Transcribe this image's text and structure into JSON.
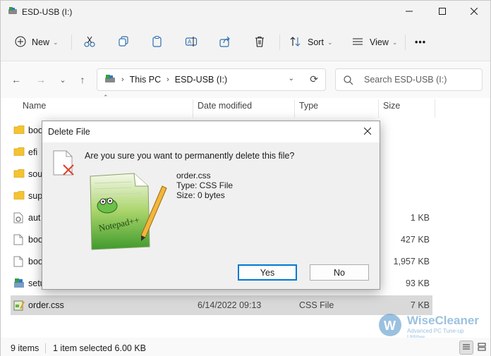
{
  "window": {
    "title": "ESD-USB (I:)"
  },
  "commandbar": {
    "new_label": "New",
    "sort_label": "Sort",
    "view_label": "View",
    "more_label": "•••"
  },
  "address": {
    "segments": [
      "This PC",
      "ESD-USB (I:)"
    ]
  },
  "search": {
    "placeholder": "Search ESD-USB (I:)"
  },
  "columns": {
    "name": "Name",
    "date": "Date modified",
    "type": "Type",
    "size": "Size"
  },
  "files": [
    {
      "name": "boo",
      "date": "",
      "type": "",
      "size": "",
      "icon": "folder-icon"
    },
    {
      "name": "efi",
      "date": "",
      "type": "",
      "size": "",
      "icon": "folder-icon"
    },
    {
      "name": "sou",
      "date": "",
      "type": "",
      "size": "",
      "icon": "folder-icon"
    },
    {
      "name": "sup",
      "date": "",
      "type": "",
      "size": "",
      "icon": "folder-icon"
    },
    {
      "name": "aut",
      "date": "",
      "type": "",
      "size": "1 KB",
      "icon": "settings-file-icon"
    },
    {
      "name": "boo",
      "date": "",
      "type": "",
      "size": "427 KB",
      "icon": "file-icon"
    },
    {
      "name": "boo",
      "date": "",
      "type": "",
      "size": "1,957 KB",
      "icon": "file-icon"
    },
    {
      "name": "setu",
      "date": "",
      "type": "",
      "size": "93 KB",
      "icon": "setup-icon"
    },
    {
      "name": "order.css",
      "date": "6/14/2022 09:13",
      "type": "CSS File",
      "size": "7 KB",
      "icon": "css-file-icon"
    }
  ],
  "status": {
    "item_count": "9 items",
    "selection": "1 item selected  6.00 KB"
  },
  "watermark": {
    "name": "WiseCleaner",
    "tagline": "Advanced PC Tune-up Utilities"
  },
  "dialog": {
    "title": "Delete File",
    "question": "Are you sure you want to permanently delete this file?",
    "file_name": "order.css",
    "file_type": "Type: CSS File",
    "file_size": "Size: 0 bytes",
    "yes_label": "Yes",
    "no_label": "No"
  },
  "colors": {
    "accent": "#0078d4",
    "folder": "#f4c430",
    "selected_row": "#d9d9d9",
    "delete_x": "#e0402a"
  }
}
